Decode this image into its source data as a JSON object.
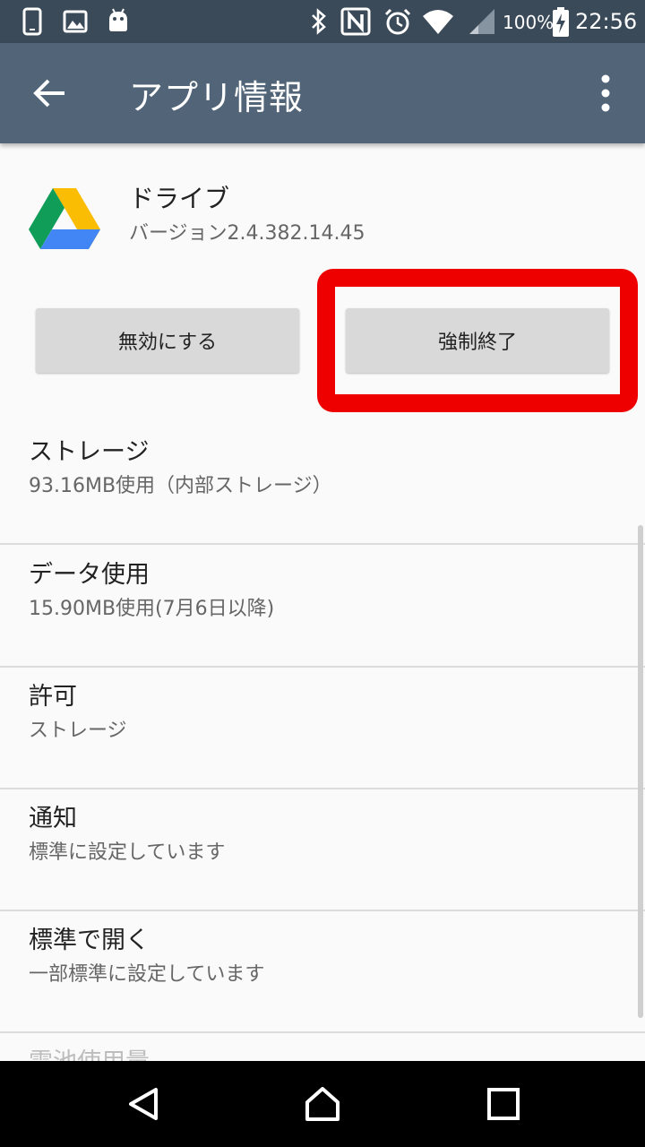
{
  "status_bar": {
    "battery_percent": "100%",
    "time": "22:56",
    "icons": [
      "phone-icon",
      "image-icon",
      "android-icon",
      "bluetooth-icon",
      "nfc-icon",
      "alarm-icon",
      "wifi-icon",
      "signal-icon",
      "battery-charging-icon"
    ]
  },
  "app_bar": {
    "title": "アプリ情報",
    "back_icon": "arrow-back-icon",
    "menu_icon": "more-vert-icon"
  },
  "app": {
    "name": "ドライブ",
    "version": "バージョン2.4.382.14.45",
    "icon": "google-drive-icon"
  },
  "buttons": {
    "disable": "無効にする",
    "force_stop": "強制終了"
  },
  "highlight_color": "#ee0000",
  "settings": [
    {
      "title": "ストレージ",
      "subtitle": "93.16MB使用（内部ストレージ）"
    },
    {
      "title": "データ使用",
      "subtitle": "15.90MB使用(7月6日以降)"
    },
    {
      "title": "許可",
      "subtitle": "ストレージ"
    },
    {
      "title": "通知",
      "subtitle": "標準に設定しています"
    },
    {
      "title": "標準で開く",
      "subtitle": "一部標準に設定しています"
    },
    {
      "title": "電池使用量"
    }
  ],
  "nav_bar": {
    "back_icon": "nav-back-icon",
    "home_icon": "nav-home-icon",
    "recents_icon": "nav-recents-icon"
  },
  "colors": {
    "status_bar": "#3b4a59",
    "app_bar": "#526477",
    "background": "#fafafa",
    "button": "#d9d9d9"
  }
}
